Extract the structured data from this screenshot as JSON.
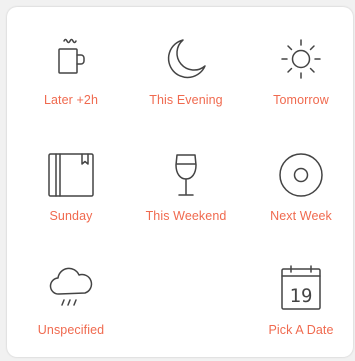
{
  "accent_color": "#f06a4f",
  "options": [
    {
      "label": "Later  +2h",
      "icon": "coffee-cup-icon"
    },
    {
      "label": "This Evening",
      "icon": "moon-icon"
    },
    {
      "label": "Tomorrow",
      "icon": "sun-icon"
    },
    {
      "label": "Sunday",
      "icon": "book-icon"
    },
    {
      "label": "This Weekend",
      "icon": "wine-glass-icon"
    },
    {
      "label": "Next Week",
      "icon": "disc-icon"
    },
    {
      "label": "Unspecified",
      "icon": "rain-cloud-icon"
    },
    {
      "label": "Pick A Date",
      "icon": "calendar-icon",
      "icon_text": "19"
    }
  ]
}
